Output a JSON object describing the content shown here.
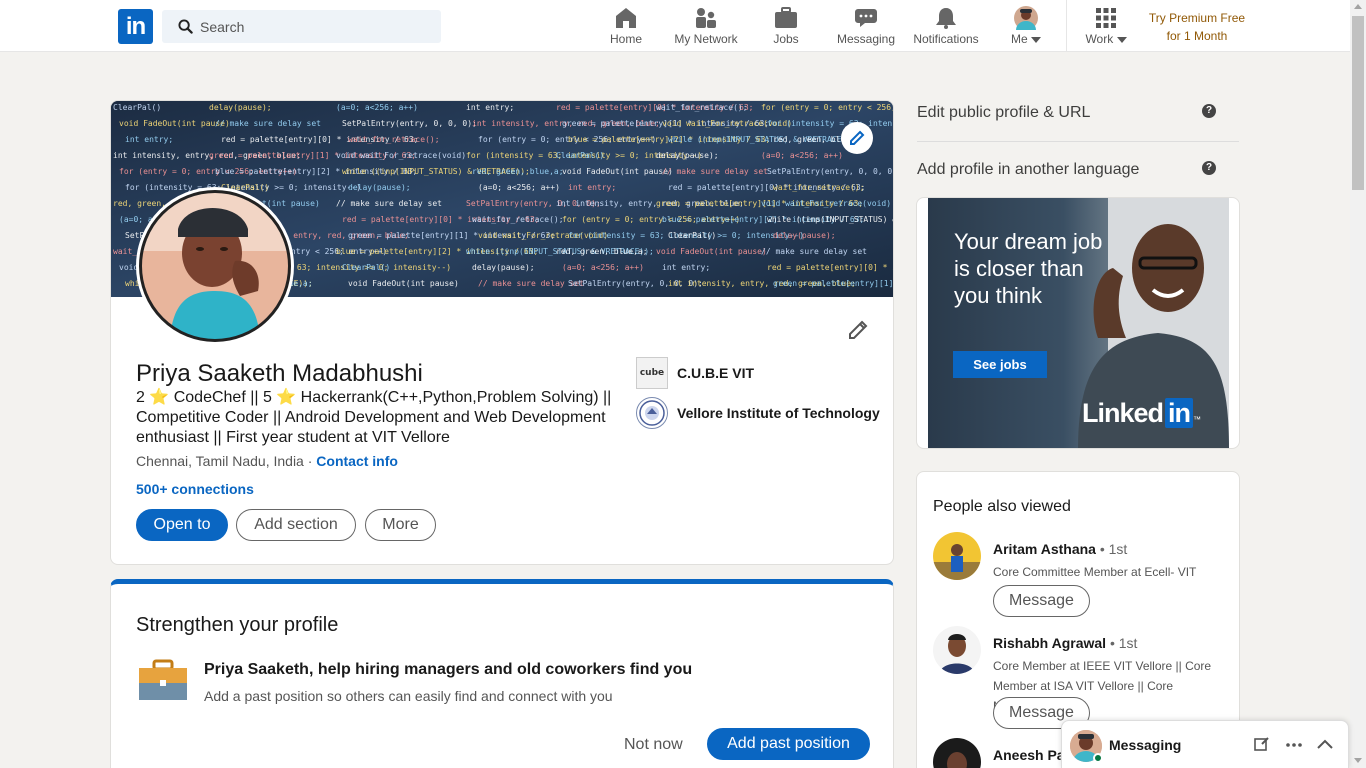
{
  "nav": {
    "logo": "in",
    "search_placeholder": "Search",
    "items": [
      {
        "label": "Home",
        "icon": "home-icon"
      },
      {
        "label": "My Network",
        "icon": "network-icon"
      },
      {
        "label": "Jobs",
        "icon": "briefcase-icon"
      },
      {
        "label": "Messaging",
        "icon": "messaging-icon"
      },
      {
        "label": "Notifications",
        "icon": "bell-icon"
      },
      {
        "label": "Me",
        "icon": "avatar"
      },
      {
        "label": "Work",
        "icon": "grid-icon"
      }
    ],
    "premium": "Try Premium Free for 1 Month",
    "premium_line1": "Try Premium Free",
    "premium_line2": "for 1 Month"
  },
  "profile": {
    "name": "Priya Saaketh Madabhushi",
    "headline": "2 ⭐ CodeChef || 5 ⭐ Hackerrank(C++,Python,Problem Solving) || Competitive Coder || Android Development and Web Development enthusiast || First year student at VIT Vellore",
    "location": "Chennai, Tamil Nadu, India",
    "separator": "·",
    "contact": "Contact info",
    "connections": "500+ connections",
    "buttons": {
      "open_to": "Open to",
      "add_section": "Add section",
      "more": "More"
    },
    "orgs": [
      {
        "name": "C.U.B.E VIT",
        "logo_text": "cube"
      },
      {
        "name": "Vellore Institute of Technology"
      }
    ],
    "banner_code": [
      "ClearPal()",
      "void FadeOut(int pause)",
      "int entry;",
      "int intensity, entry, red, green, blue;",
      "for (entry = 0; entry < 256; entry++)",
      "for (intensity = 63; intensity >= 0; intensity--)",
      "red, green, blue,a;",
      "(a=0; a<256; a++)",
      "SetPalEntry(entry, 0, 0, 0);",
      "wait_for_retrace();",
      "void wait_For_retrace(void)",
      "while ((inp(INPUT_STATUS) & VRETRACE));",
      "delay(pause);",
      "// make sure delay set",
      "red = palette[entry][0] * intensity / 63;",
      "green = palette[entry][1] * intensity / 63;",
      "blue = palette[entry][2] * intensity / 63;"
    ]
  },
  "strengthen": {
    "title": "Strengthen your profile",
    "heading": "Priya Saaketh, help hiring managers and old coworkers find you",
    "sub": "Add a past position so others can easily find and connect with you",
    "not_now": "Not now",
    "add_past": "Add past position"
  },
  "sidebar": {
    "edit_public": "Edit public profile & URL",
    "add_language": "Add profile in another language",
    "help": "?",
    "ad": {
      "text": "Your dream job is closer than you think",
      "button": "See jobs",
      "brand_word": "Linked",
      "brand_in": "in",
      "tm": "™"
    },
    "pav": {
      "title": "People also viewed",
      "people": [
        {
          "name": "Aritam Asthana",
          "degree": "• 1st",
          "desc": "Core Committee Member at Ecell- VIT"
        },
        {
          "name": "Rishabh Agrawal",
          "degree": "• 1st",
          "desc": "Core Member at IEEE VIT Vellore || Core Member at ISA VIT Vellore || Core Member..."
        },
        {
          "name": "Aneesh Par",
          "degree": "",
          "desc": ""
        }
      ],
      "message": "Message"
    }
  },
  "messaging": {
    "label": "Messaging"
  },
  "colors": {
    "brand": "#0a66c2",
    "premium": "#915907",
    "online": "#057642"
  }
}
